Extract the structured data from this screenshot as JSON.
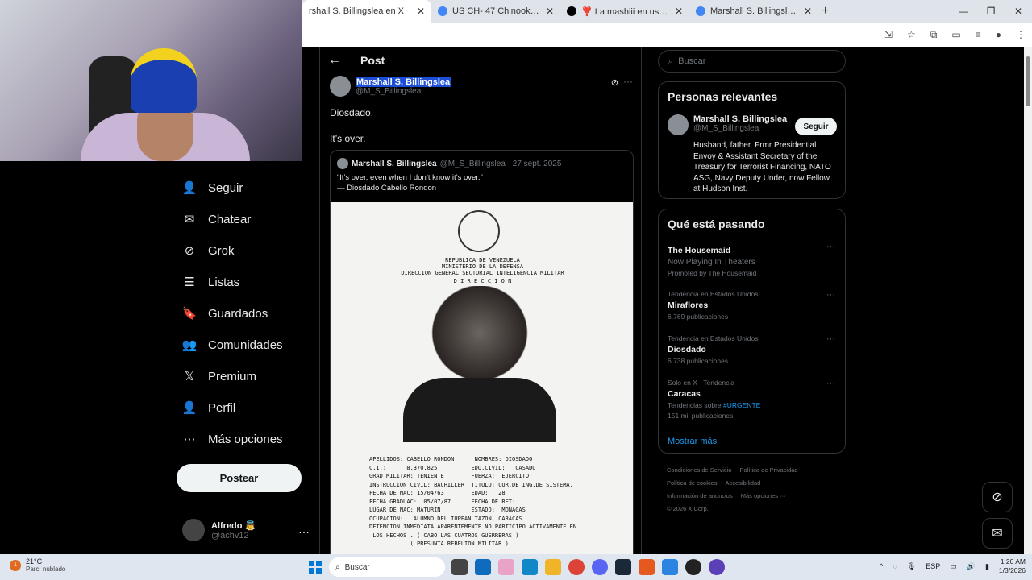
{
  "browser": {
    "tabs": [
      {
        "title": "rshall S. Billingslea en X",
        "active": true,
        "favicon_color": "#000000"
      },
      {
        "title": "US CH- 47 Chinook - Buscar co",
        "active": false,
        "favicon_color": "#4285f4"
      },
      {
        "title": "❣️ La mashiii en usa💗 (@lama",
        "active": false,
        "favicon_color": "#000000"
      },
      {
        "title": "Marshall S. Billingslea - Buscar c",
        "active": false,
        "favicon_color": "#4285f4"
      }
    ],
    "new_tab": "+",
    "window_controls": [
      "—",
      "❐",
      "✕"
    ]
  },
  "sidebar": {
    "items": [
      {
        "label": "Seguir",
        "icon": "person-add-icon"
      },
      {
        "label": "Chatear",
        "icon": "mail-icon"
      },
      {
        "label": "Grok",
        "icon": "grok-icon"
      },
      {
        "label": "Listas",
        "icon": "list-icon"
      },
      {
        "label": "Guardados",
        "icon": "bookmark-icon"
      },
      {
        "label": "Comunidades",
        "icon": "communities-icon"
      },
      {
        "label": "Premium",
        "icon": "x-logo-icon"
      },
      {
        "label": "Perfil",
        "icon": "profile-icon"
      },
      {
        "label": "Más opciones",
        "icon": "more-circle-icon"
      }
    ],
    "post_button": "Postear",
    "account": {
      "name": "Alfredo 👼",
      "handle": "@achv12",
      "more": "···"
    }
  },
  "post": {
    "header_title": "Post",
    "author_name": "Marshall S. Billingslea",
    "author_handle": "@M_S_Billingslea",
    "text": "Diosdado,\n\nIt’s over.",
    "more": "···",
    "quote": {
      "author_name": "Marshall S. Billingslea",
      "author_meta": "@M_S_Billingslea · 27 sept. 2025",
      "text": "“It’s over, even when I don’t know it’s over.”\n          — Diosdado Cabello Rondon",
      "doc": {
        "header_lines": [
          "REPUBLICA DE VENEZUELA",
          "MINISTERIO DE LA DEFENSA",
          "DIRECCION GENERAL SECTORIAL INTELIGENCIA MILITAR",
          "D I R E C C I O N"
        ],
        "fields": "APELLIDOS: CABELLO RONDON      NOMBRES: DIOSDADO\nC.I.:      8.370.825          EDO.CIVIL:   CASADO\nGRAD MILITAR: TENIENTE        FUERZA:  EJERCITO\nINSTRUCCION CIVIL: BACHILLER  TITULO: CUR.DE ING.DE SISTEMA.\nFECHA DE NAC: 15/04/63        EDAD:   28\nFECHA GRADUAC:  05/07/87      FECHA DE RET:\nLUGAR DE NAC: MATURIN         ESTADO:  MONAGAS\nOCUPACION:   ALUMNO DEL IUPFAN TAZON. CARACAS\nDETENCION INMEDIATA APARENTEMENTE NO PARTICIPO ACTIVAMENTE EN\n LOS HECHOS . ( CABO LAS CUATROS GUERRERAS )\n            ( PRESUNTA REBELION MILITAR )"
      }
    }
  },
  "right": {
    "search_placeholder": "Buscar",
    "relevant": {
      "title": "Personas relevantes",
      "name": "Marshall S. Billingslea",
      "handle": "@M_S_Billingslea",
      "follow": "Seguir",
      "bio": "Husband, father. Frmr Presidential Envoy & Assistant Secretary of the Treasury for Terrorist Financing, NATO ASG, Navy Deputy Under, now Fellow at Hudson Inst."
    },
    "trending": {
      "title": "Qué está pasando",
      "promo": {
        "name": "The Housemaid",
        "sub": "Now Playing In Theaters",
        "promoted": "Promoted by The Housemaid"
      },
      "items": [
        {
          "context": "Tendencia en Estados Unidos",
          "name": "Miraflores",
          "count": "6.769 publicaciones"
        },
        {
          "context": "Tendencia en Estados Unidos",
          "name": "Diosdado",
          "count": "6.738 publicaciones"
        },
        {
          "context": "Solo en X · Tendencia",
          "name": "Caracas",
          "topic_prefix": "Tendencias sobre",
          "topic": "#URGENTE",
          "count": "151 mil publicaciones"
        }
      ],
      "show_more": "Mostrar más"
    },
    "footer": {
      "links": [
        "Condiciones de Servicio",
        "Política de Privacidad",
        "Política de cookies",
        "Accesibilidad",
        "Información de anuncios",
        "Más opciones ···"
      ],
      "copyright": "© 2026 X Corp."
    }
  },
  "taskbar": {
    "weather_temp": "21°C",
    "weather_desc": "Parc. nublado",
    "weather_badge": "1",
    "search": "Buscar",
    "lang": "ESP",
    "time": "1:20 AM",
    "date": "1/3/2026"
  }
}
